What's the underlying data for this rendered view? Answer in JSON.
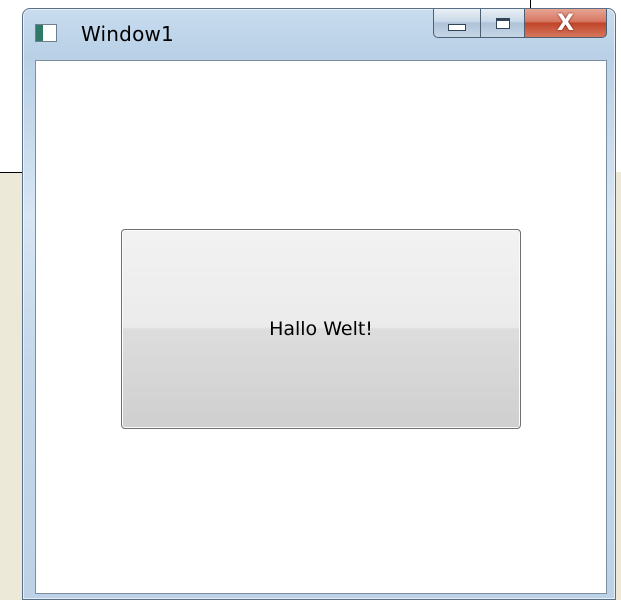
{
  "window": {
    "title": "Window1",
    "icon": "app-window-icon",
    "caption_buttons": {
      "minimize": "minimize-icon",
      "maximize": "maximize-icon",
      "close_label": "X"
    }
  },
  "content": {
    "button_label": "Hallo Welt!"
  },
  "colors": {
    "close_button": "#c0452a",
    "frame": "#c4d8ea",
    "client_background": "#ffffff"
  }
}
